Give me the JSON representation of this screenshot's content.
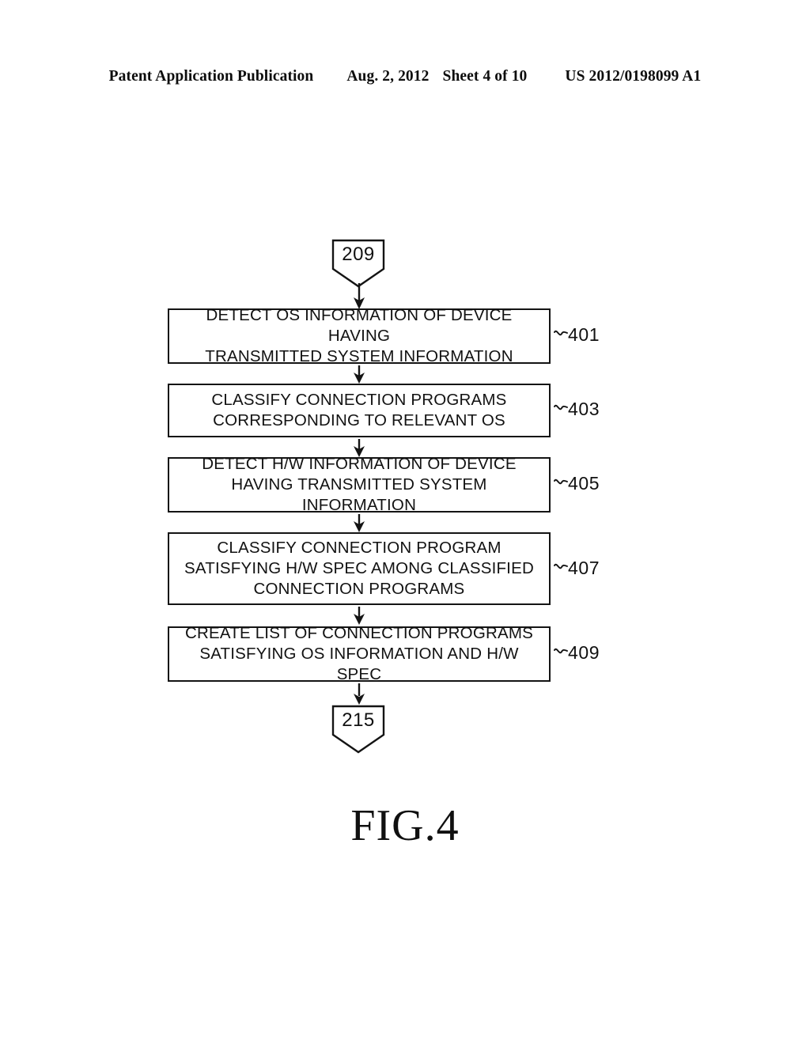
{
  "header": {
    "publication": "Patent Application Publication",
    "date": "Aug. 2, 2012",
    "sheet": "Sheet 4 of 10",
    "patent_number": "US 2012/0198099 A1"
  },
  "figure": {
    "caption": "FIG.4"
  },
  "flowchart": {
    "type": "flowchart",
    "entry": {
      "label": "209",
      "shape": "pentagon-connector"
    },
    "exit": {
      "label": "215",
      "shape": "pentagon-connector"
    },
    "steps": [
      {
        "ref": "401",
        "text": "DETECT OS INFORMATION OF DEVICE HAVING\nTRANSMITTED SYSTEM INFORMATION",
        "lines": 2
      },
      {
        "ref": "403",
        "text": "CLASSIFY CONNECTION PROGRAMS\nCORRESPONDING TO RELEVANT OS",
        "lines": 2
      },
      {
        "ref": "405",
        "text": "DETECT H/W INFORMATION OF DEVICE\nHAVING TRANSMITTED SYSTEM INFORMATION",
        "lines": 2
      },
      {
        "ref": "407",
        "text": "CLASSIFY CONNECTION PROGRAM\nSATISFYING H/W SPEC AMONG CLASSIFIED\nCONNECTION PROGRAMS",
        "lines": 3
      },
      {
        "ref": "409",
        "text": "CREATE LIST OF CONNECTION PROGRAMS\nSATISFYING OS INFORMATION AND H/W SPEC",
        "lines": 2
      }
    ]
  },
  "colors": {
    "ink": "#111111",
    "shadow": "#4a4a4a",
    "paper": "#ffffff"
  }
}
